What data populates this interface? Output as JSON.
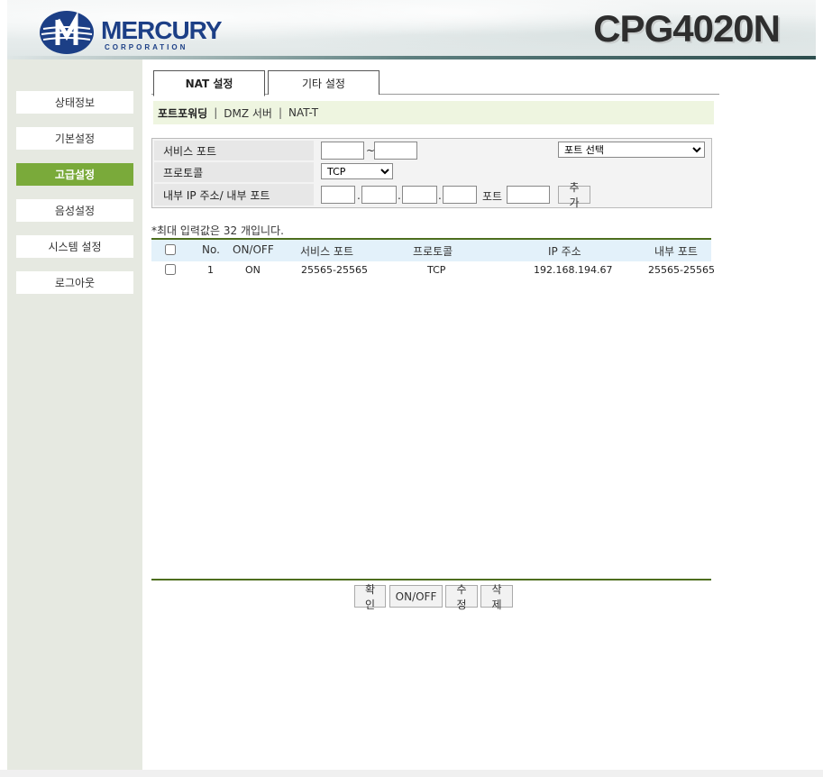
{
  "header": {
    "logo_name": "MERCURY",
    "logo_sub": "CORPORATION",
    "model": "CPG4020N"
  },
  "sidebar": {
    "items": [
      {
        "label": "상태정보",
        "active": false
      },
      {
        "label": "기본설정",
        "active": false
      },
      {
        "label": "고급설정",
        "active": true
      },
      {
        "label": "음성설정",
        "active": false
      },
      {
        "label": "시스템 설정",
        "active": false
      },
      {
        "label": "로그아웃",
        "active": false
      }
    ]
  },
  "tabs": [
    {
      "label": "NAT 설정",
      "active": true
    },
    {
      "label": "기타 설정",
      "active": false
    }
  ],
  "subnav": {
    "items": [
      "포트포워딩",
      "DMZ 서버",
      "NAT-T"
    ],
    "separator": "|"
  },
  "form": {
    "service_port_label": "서비스 포트",
    "range_sep": "~",
    "port_select_value": "포트 선택",
    "protocol_label": "프로토콜",
    "protocol_value": "TCP",
    "internal_label": "내부 IP 주소/ 내부 포트",
    "ip_dot": ".",
    "port_label": "포트",
    "add_button": "추가"
  },
  "note": "*최대 입력값은 32 개입니다.",
  "table": {
    "headers": [
      "No.",
      "ON/OFF",
      "서비스 포트",
      "프로토콜",
      "IP 주소",
      "내부 포트"
    ],
    "rows": [
      {
        "no": "1",
        "onoff": "ON",
        "service_port": "25565-25565",
        "protocol": "TCP",
        "ip": "192.168.194.67",
        "internal_port": "25565-25565"
      }
    ]
  },
  "actions": [
    "확인",
    "ON/OFF",
    "수정",
    "삭제"
  ],
  "colors": {
    "brand": "#1c3f86",
    "sidebar_active": "#7aaa3a",
    "table_rule": "#4d6e1e",
    "table_head": "#e3f1fa",
    "subnav_bg": "#eef5e0"
  }
}
